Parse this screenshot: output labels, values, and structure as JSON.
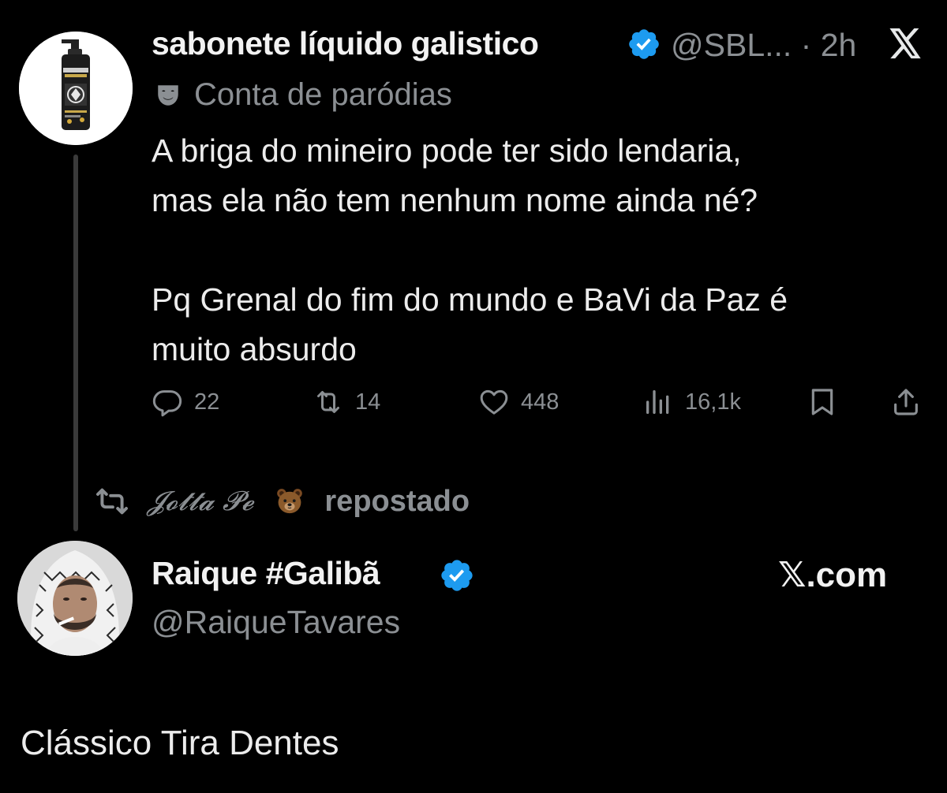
{
  "tweet": {
    "display_name": "sabonete líquido galistico",
    "handle_time": "@SBL... · 2h",
    "parody_label": "Conta de paródias",
    "text": "A briga do mineiro pode ter sido lendaria,\nmas ela não tem nenhum nome ainda né?\n\nPq Grenal do fim do mundo e BaVi da Paz é\nmuito absurdo",
    "avatar_label": "sabonete liquido",
    "stats": {
      "replies": "22",
      "reposts": "14",
      "likes": "448",
      "views": "16,1k"
    },
    "icons": {
      "reply": "reply-icon",
      "repost": "repost-icon",
      "like": "heart-icon",
      "views": "views-icon",
      "bookmark": "bookmark-icon",
      "share": "share-icon",
      "verified": "verified-badge-icon",
      "x_logo": "x-logo-icon",
      "parody": "theater-mask-icon"
    }
  },
  "repost": {
    "user": "𝓙𝓸𝓽𝓽𝓪 𝓟𝓮",
    "apple": "",
    "label": "repostado"
  },
  "quoted": {
    "display_name": "Raique #Galibã",
    "handle": "@RaiqueTavares",
    "site": "𝕏.com",
    "text": "Clássico Tira Dentes"
  },
  "colors": {
    "background": "#000000",
    "primary_text": "#e7e9ea",
    "secondary_text": "#8b8f93",
    "verified": "#1d9bf0"
  }
}
